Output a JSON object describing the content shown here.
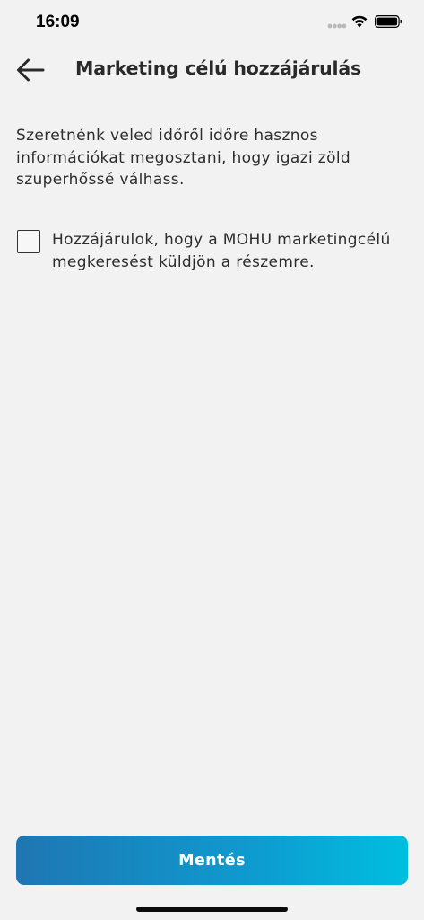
{
  "status_bar": {
    "time": "16:09",
    "icons": [
      "signal-icon",
      "wifi-icon",
      "battery-icon"
    ]
  },
  "header": {
    "back_icon": "arrow-left-icon",
    "title": "Marketing célú hozzájárulás"
  },
  "content": {
    "intro": "Szeretnénk veled időről időre hasznos információkat megosztani, hogy igazi zöld szuperhőssé válhass.",
    "consent": {
      "checked": false,
      "label": "Hozzájárulok, hogy a MOHU marketingcélú megkeresést küldjön a részemre."
    }
  },
  "footer": {
    "save_label": "Mentés"
  },
  "colors": {
    "background": "#f2f2f2",
    "button_gradient_start": "#1f76b2",
    "button_gradient_end": "#00bedf",
    "text": "#2d2d2d"
  }
}
